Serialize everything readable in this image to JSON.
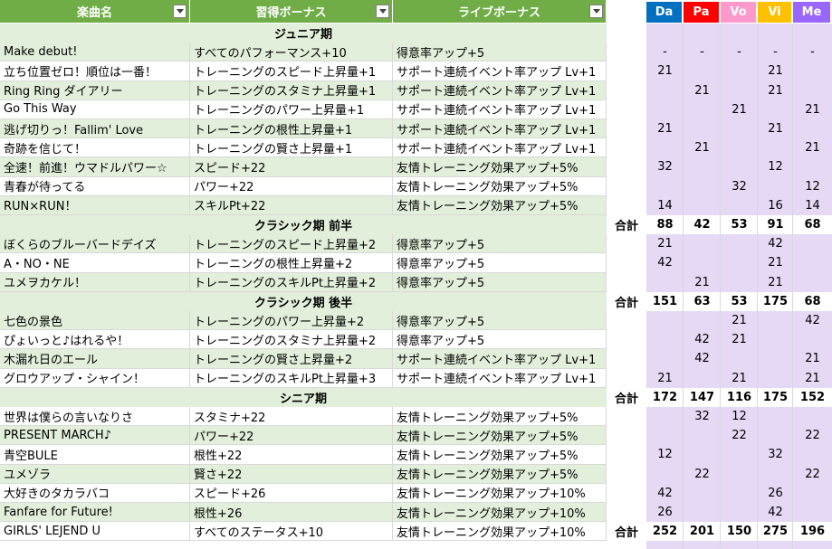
{
  "headers": {
    "song": "楽曲名",
    "skill": "習得ボーナス",
    "live": "ライブボーナス"
  },
  "stats": [
    {
      "label": "Da",
      "color": "#0070c0"
    },
    {
      "label": "Pa",
      "color": "#ff0000"
    },
    {
      "label": "Vo",
      "color": "#ff99cc"
    },
    {
      "label": "Vi",
      "color": "#ffc000"
    },
    {
      "label": "Me",
      "color": "#9966ff"
    }
  ],
  "total_label": "合計",
  "rows": [
    {
      "type": "section",
      "title": "ジュニア期"
    },
    {
      "type": "row",
      "song": "Make debut!",
      "skill": "すべてのパフォーマンス+10",
      "live": "得意率アップ+5",
      "vals": [
        "-",
        "-",
        "-",
        "-",
        "-"
      ]
    },
    {
      "type": "row",
      "song": "立ち位置ゼロ！順位は一番！",
      "skill": "トレーニングのスピード上昇量+1",
      "live": "サポート連続イベント率アップ Lv+1",
      "vals": [
        "21",
        "",
        "",
        "21",
        ""
      ]
    },
    {
      "type": "row",
      "song": "Ring Ring ダイアリー",
      "skill": "トレーニングのスタミナ上昇量+1",
      "live": "サポート連続イベント率アップ Lv+1",
      "vals": [
        "",
        "21",
        "",
        "21",
        ""
      ]
    },
    {
      "type": "row",
      "song": "Go This Way",
      "skill": "トレーニングのパワー上昇量+1",
      "live": "サポート連続イベント率アップ Lv+1",
      "vals": [
        "",
        "",
        "21",
        "",
        "21"
      ]
    },
    {
      "type": "row",
      "song": "逃げ切りっ！Fallim' Love",
      "skill": "トレーニングの根性上昇量+1",
      "live": "サポート連続イベント率アップ Lv+1",
      "vals": [
        "21",
        "",
        "",
        "21",
        ""
      ]
    },
    {
      "type": "row",
      "song": "奇跡を信じて！",
      "skill": "トレーニングの賢さ上昇量+1",
      "live": "サポート連続イベント率アップ Lv+1",
      "vals": [
        "",
        "21",
        "",
        "",
        "21"
      ]
    },
    {
      "type": "row",
      "song": "全速！前進！ウマドルパワー☆",
      "skill": "スピード+22",
      "live": "友情トレーニング効果アップ+5%",
      "vals": [
        "32",
        "",
        "",
        "12",
        ""
      ]
    },
    {
      "type": "row",
      "song": "青春が待ってる",
      "skill": "パワー+22",
      "live": "友情トレーニング効果アップ+5%",
      "vals": [
        "",
        "",
        "32",
        "",
        "12"
      ]
    },
    {
      "type": "row",
      "song": "RUN×RUN！",
      "skill": "スキルPt+22",
      "live": "友情トレーニング効果アップ+5%",
      "vals": [
        "14",
        "",
        "",
        "16",
        "14"
      ]
    },
    {
      "type": "section",
      "title": "クラシック期 前半",
      "total": true,
      "vals": [
        "88",
        "42",
        "53",
        "91",
        "68"
      ]
    },
    {
      "type": "row",
      "song": "ぼくらのブルーバードデイズ",
      "skill": "トレーニングのスピード上昇量+2",
      "live": "得意率アップ+5",
      "vals": [
        "21",
        "",
        "",
        "42",
        ""
      ]
    },
    {
      "type": "row",
      "song": "A・NO・NE",
      "skill": "トレーニングの根性上昇量+2",
      "live": "得意率アップ+5",
      "vals": [
        "42",
        "",
        "",
        "21",
        ""
      ]
    },
    {
      "type": "row",
      "song": "ユメヲカケル！",
      "skill": "トレーニングのスキルPt上昇量+2",
      "live": "得意率アップ+5",
      "vals": [
        "",
        "21",
        "",
        "21",
        ""
      ]
    },
    {
      "type": "section",
      "title": "クラシック期 後半",
      "total": true,
      "vals": [
        "151",
        "63",
        "53",
        "175",
        "68"
      ]
    },
    {
      "type": "row",
      "song": "七色の景色",
      "skill": "トレーニングのパワー上昇量+2",
      "live": "得意率アップ+5",
      "vals": [
        "",
        "",
        "21",
        "",
        "42"
      ]
    },
    {
      "type": "row",
      "song": "ぴょいっと♪はれるや！",
      "skill": "トレーニングのスタミナ上昇量+2",
      "live": "得意率アップ+5",
      "vals": [
        "",
        "42",
        "21",
        "",
        ""
      ]
    },
    {
      "type": "row",
      "song": "木漏れ日のエール",
      "skill": "トレーニングの賢さ上昇量+2",
      "live": "サポート連続イベント率アップ Lv+1",
      "vals": [
        "",
        "42",
        "",
        "",
        "21"
      ]
    },
    {
      "type": "row",
      "song": "グロウアップ・シャイン！",
      "skill": "トレーニングのスキルPt上昇量+3",
      "live": "サポート連続イベント率アップ Lv+1",
      "vals": [
        "21",
        "",
        "21",
        "",
        "21"
      ]
    },
    {
      "type": "section",
      "title": "シニア期",
      "total": true,
      "vals": [
        "172",
        "147",
        "116",
        "175",
        "152"
      ]
    },
    {
      "type": "row",
      "song": "世界は僕らの言いなりさ",
      "skill": "スタミナ+22",
      "live": "友情トレーニング効果アップ+5%",
      "vals": [
        "",
        "32",
        "12",
        "",
        ""
      ]
    },
    {
      "type": "row",
      "song": "PRESENT MARCH♪",
      "skill": "パワー+22",
      "live": "友情トレーニング効果アップ+5%",
      "vals": [
        "",
        "",
        "22",
        "",
        "22"
      ]
    },
    {
      "type": "row",
      "song": "青空BULE",
      "skill": "根性+22",
      "live": "友情トレーニング効果アップ+5%",
      "vals": [
        "12",
        "",
        "",
        "32",
        ""
      ]
    },
    {
      "type": "row",
      "song": "ユメゾラ",
      "skill": "賢さ+22",
      "live": "友情トレーニング効果アップ+5%",
      "vals": [
        "",
        "22",
        "",
        "",
        "22"
      ]
    },
    {
      "type": "row",
      "song": "大好きのタカラバコ",
      "skill": "スピード+26",
      "live": "友情トレーニング効果アップ+10%",
      "vals": [
        "42",
        "",
        "",
        "26",
        ""
      ]
    },
    {
      "type": "row",
      "song": "Fanfare for Future!",
      "skill": "根性+26",
      "live": "友情トレーニング効果アップ+10%",
      "vals": [
        "26",
        "",
        "",
        "42",
        ""
      ]
    },
    {
      "type": "row",
      "song": "GIRLS' LEJEND U",
      "skill": "すべてのステータス+10",
      "live": "友情トレーニング効果アップ+10%",
      "vals": [
        "",
        "",
        "",
        "",
        ""
      ],
      "total": true,
      "tvals": [
        "252",
        "201",
        "150",
        "275",
        "196"
      ]
    }
  ]
}
